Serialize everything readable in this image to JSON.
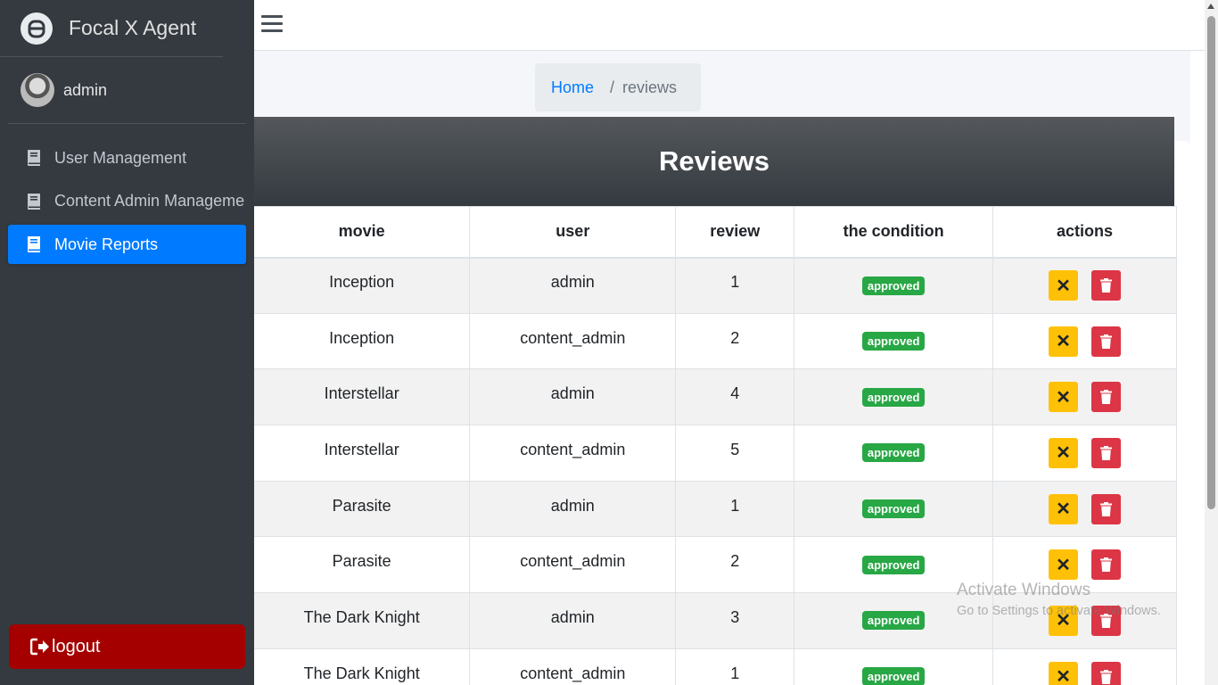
{
  "brand": {
    "name": "Focal X Agent"
  },
  "user": {
    "name": "admin"
  },
  "sidebar": {
    "items": [
      {
        "label": "User Management",
        "active": false
      },
      {
        "label": "Content Admin Manageme",
        "active": false
      },
      {
        "label": "Movie Reports",
        "active": true
      }
    ],
    "logout_label": "logout"
  },
  "breadcrumb": {
    "home": "Home",
    "separator": "/",
    "current": "reviews"
  },
  "card": {
    "title": "Reviews"
  },
  "table": {
    "columns": [
      "movie",
      "user",
      "review",
      "the condition",
      "actions"
    ],
    "rows": [
      {
        "movie": "Inception",
        "user": "admin",
        "review": "1",
        "condition": "approved"
      },
      {
        "movie": "Inception",
        "user": "content_admin",
        "review": "2",
        "condition": "approved"
      },
      {
        "movie": "Interstellar",
        "user": "admin",
        "review": "4",
        "condition": "approved"
      },
      {
        "movie": "Interstellar",
        "user": "content_admin",
        "review": "5",
        "condition": "approved"
      },
      {
        "movie": "Parasite",
        "user": "admin",
        "review": "1",
        "condition": "approved"
      },
      {
        "movie": "Parasite",
        "user": "content_admin",
        "review": "2",
        "condition": "approved"
      },
      {
        "movie": "The Dark Knight",
        "user": "admin",
        "review": "3",
        "condition": "approved"
      },
      {
        "movie": "The Dark Knight",
        "user": "content_admin",
        "review": "1",
        "condition": "approved"
      }
    ],
    "reject_glyph": "✕"
  },
  "watermark": {
    "title": "Activate Windows",
    "subtitle": "Go to Settings to activate Windows."
  },
  "colors": {
    "sidebar_bg": "#343a40",
    "active": "#007bff",
    "approved": "#28a745",
    "warning": "#ffc107",
    "danger": "#dc3545",
    "logout": "#a50000"
  }
}
